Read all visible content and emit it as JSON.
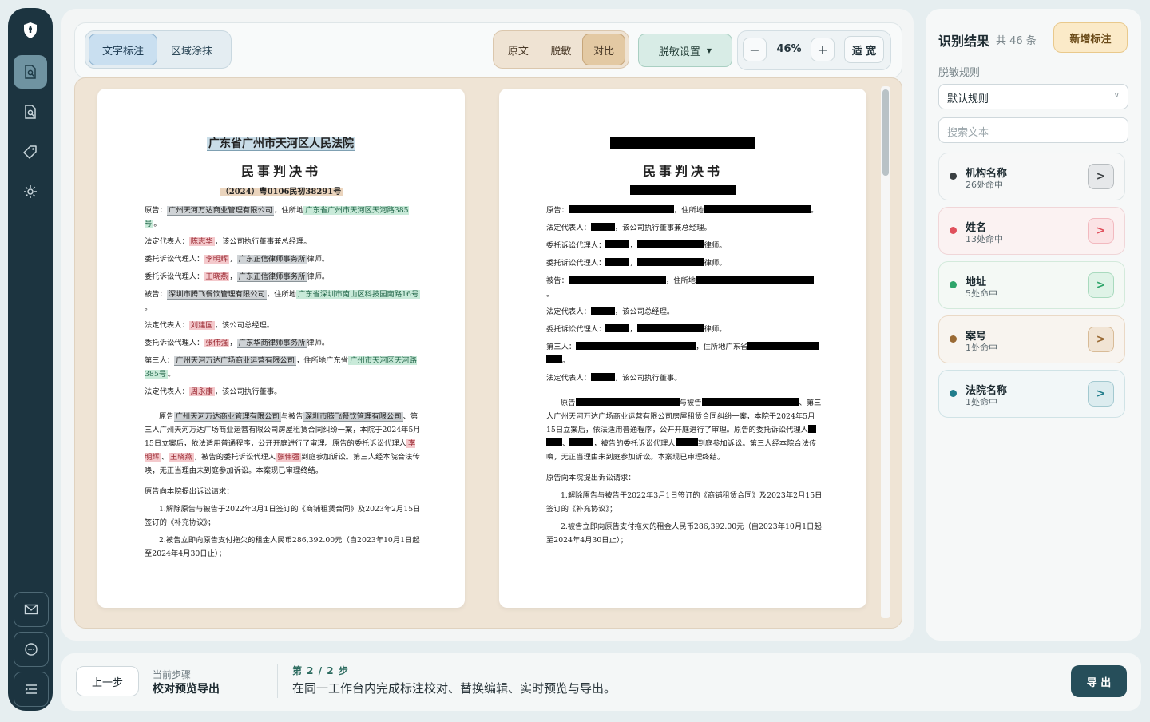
{
  "toolbar": {
    "mode_tabs": [
      {
        "label": "文字标注"
      },
      {
        "label": "区域涂抹"
      }
    ],
    "view_tabs": [
      {
        "label": "原文"
      },
      {
        "label": "脱敏"
      },
      {
        "label": "对比"
      }
    ],
    "settings_label": "脱敏设置",
    "zoom_value": "46%",
    "zoom_minus": "−",
    "zoom_plus": "+",
    "fit_label": "适 宽"
  },
  "doc": {
    "court": "广东省广州市天河区人民法院",
    "title": "民事判决书",
    "case_no": "（2024）粤0106民初38291号",
    "plaintiff_label": "原告：",
    "plaintiff": "广州天河万达商业管理有限公司",
    "plaintiff_addr_label": "，住所地",
    "plaintiff_addr": "广东省广州市天河区天河路385号",
    "legal_rep_label": "法定代表人：",
    "legal_rep1": "陈志华",
    "legal_rep1_tail": "，该公司执行董事兼总经理。",
    "agent_label": "委托诉讼代理人：",
    "agent1": "李明辉",
    "agent2": "王晓燕",
    "lawfirm1": "广东正信律师事务所",
    "lawfirm_tail": "律师。",
    "defendant_label": "被告：",
    "defendant": "深圳市腾飞餐饮管理有限公司",
    "defendant_addr": "广东省深圳市南山区科技园南路16号",
    "period": "。",
    "legal_rep2": "刘建国",
    "legal_rep2_tail": "，该公司总经理。",
    "agent3": "张伟强",
    "lawfirm2": "广东华商律师事务所",
    "third_label": "第三人：",
    "third": "广州天河万达广场商业运营有限公司",
    "third_addr_pre": "，住所地广东省",
    "third_addr": "广州市天河区天河路385号",
    "legal_rep3": "周永康",
    "legal_rep3_tail": "，该公司执行董事。",
    "p1_a": "原告",
    "p1_b": "与被告",
    "p1_c": "、第三人广州天河万达广场商业运营有限公司房屋租赁合同纠纷一案，本院于2024年5月15日立案后，依法适用普通程序，公开开庭进行了审理。原告的委托诉讼代理人",
    "p1_d": "、",
    "p1_e": "，被告的委托诉讼代理人",
    "p1_f": "到庭参加诉讼。第三人经本院合法传唤，无正当理由未到庭参加诉讼。本案现已审理终结。",
    "claims_intro": "原告向本院提出诉讼请求：",
    "claim1": "1.解除原告与被告于2022年3月1日签订的《商铺租赁合同》及2023年2月15日签订的《补充协议》；",
    "claim2": "2.被告立即向原告支付拖欠的租金人民币286,392.00元（自2023年10月1日起至2024年4月30日止）；",
    "right_p1_c": "、第三人广州天河万达广场商业运营有限公司房屋租赁合同纠纷一案，本院于2024年5月15日立案后，依法适用普通程序，公开开庭进行了审理。原告的委托诉讼代理人"
  },
  "panel": {
    "title": "识别结果",
    "count": "共 46 条",
    "add_label": "新增标注",
    "rule_label": "脱敏规则",
    "rule_value": "默认规则",
    "search_placeholder": "搜索文本",
    "categories": [
      {
        "name": "机构名称",
        "hits": "26处命中",
        "color": "#3a3f42"
      },
      {
        "name": "姓名",
        "hits": "13处命中",
        "color": "#e0505c"
      },
      {
        "name": "地址",
        "hits": "5处命中",
        "color": "#2ea56a"
      },
      {
        "name": "案号",
        "hits": "1处命中",
        "color": "#9a6a34"
      },
      {
        "name": "法院名称",
        "hits": "1处命中",
        "color": "#217d8c"
      }
    ],
    "go_glyph": ">"
  },
  "footer": {
    "prev_label": "上一步",
    "step_caption": "当前步骤",
    "step_name": "校对预览导出",
    "step_num": "第 2 / 2 步",
    "step_desc": "在同一工作台内完成标注校对、替换编辑、实时预览与导出。",
    "export_label": "导 出"
  },
  "icons": [
    "shield-icon",
    "document-search-icon",
    "file-search-icon",
    "tag-icon",
    "gear-icon",
    "mail-icon",
    "chat-icon",
    "menu-icon"
  ]
}
